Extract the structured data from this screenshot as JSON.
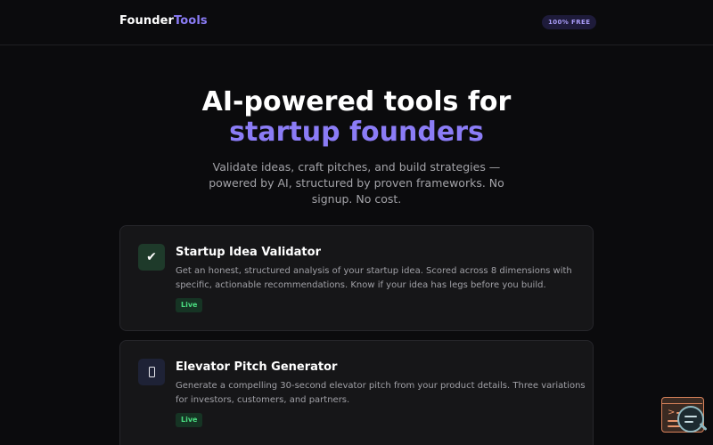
{
  "header": {
    "logo_part1": "Founder",
    "logo_part2": "Tools",
    "badge": "100% FREE"
  },
  "hero": {
    "title_line1": "AI-powered tools for",
    "title_line2": "startup founders",
    "subtitle": "Validate ideas, craft pitches, and build strategies — powered by AI, structured by proven frameworks. No signup. No cost."
  },
  "tools": [
    {
      "icon": "checkmark-icon",
      "icon_glyph": "✔",
      "title": "Startup Idea Validator",
      "description": "Get an honest, structured analysis of your startup idea. Scored across 8 dimensions with specific, actionable recommendations. Know if your idea has legs before you build.",
      "status": "Live"
    },
    {
      "icon": "phone-icon",
      "title": "Elevator Pitch Generator",
      "description": "Generate a compelling 30-second elevator pitch from your product details. Three variations for investors, customers, and partners.",
      "status": "Live"
    }
  ],
  "colors": {
    "background": "#0b0b0d",
    "accent": "#8b7cf6",
    "live_green": "#4ade80",
    "card_bg": "#161618"
  }
}
